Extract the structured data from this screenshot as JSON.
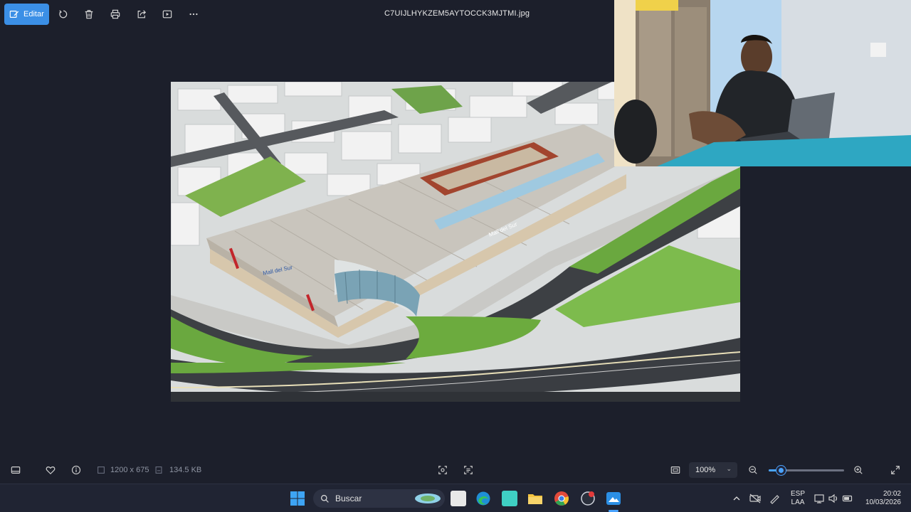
{
  "toolbar": {
    "edit_label": "Editar",
    "icons": [
      "rotate-icon",
      "delete-icon",
      "print-icon",
      "share-icon",
      "slideshow-icon",
      "more-icon"
    ],
    "filename": "C7UIJLHYKZEM5AYTOCCK3MJTMI.jpg"
  },
  "photo": {
    "subject": "aerial-mall-rendering",
    "sign_text": "Mall del Sur"
  },
  "webcam": {
    "subject": "webcam-overlay"
  },
  "infobar": {
    "dimensions": "1200 x 675",
    "file_size": "134.5 KB",
    "zoom_level": "100%",
    "zoom_fraction": 0.15
  },
  "taskbar": {
    "search_placeholder": "Buscar",
    "lang_line1": "ESP",
    "lang_line2": "LAA",
    "time": "20:02",
    "date": "10/03/2026"
  },
  "colors": {
    "accent": "#3b8fe6",
    "background": "#1c1f2b"
  }
}
